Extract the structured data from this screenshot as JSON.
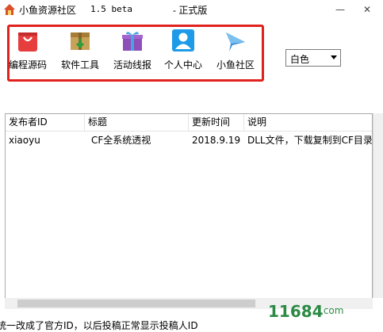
{
  "window": {
    "title": "小鱼资源社区",
    "version": "1.5 beta",
    "edition": "- 正式版",
    "minimize_glyph": "—",
    "close_glyph": "✕"
  },
  "toolbar": {
    "items": [
      {
        "label": "编程源码",
        "icon": "shopping-bag-icon",
        "color": "#e63d3d"
      },
      {
        "label": "软件工具",
        "icon": "package-box-icon",
        "color": "#b58a3c"
      },
      {
        "label": "活动线报",
        "icon": "gift-box-icon",
        "color": "#8e4fb8"
      },
      {
        "label": "个人中心",
        "icon": "user-profile-icon",
        "color": "#1e9be8"
      },
      {
        "label": "小鱼社区",
        "icon": "fish-icon",
        "color": "#3b8fd6"
      }
    ],
    "highlight_color": "#e0211d"
  },
  "skin_select": {
    "value": "白色"
  },
  "table": {
    "columns": [
      "发布者ID",
      "标题",
      "更新时间",
      "说明"
    ],
    "rows": [
      [
        "xiaoyu",
        "CF全系统透视",
        "2018.9.19",
        "DLL文件，下载复制到CF目录"
      ]
    ]
  },
  "status": {
    "text": "统一改成了官方ID，以后投稿正常显示投稿人ID"
  },
  "watermark": {
    "text": "11684",
    "suffix": ".com"
  }
}
